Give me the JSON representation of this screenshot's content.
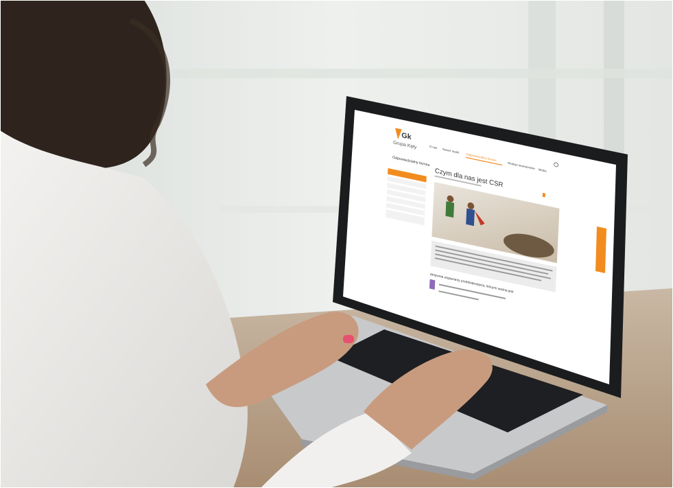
{
  "site": {
    "logo_text": "Gk",
    "logo_subtext": "Grupa Kęty",
    "nav": [
      "O nas",
      "Nasze marki",
      "Odpowiedzialny biznes",
      "Relacje inwestorskie",
      "Media"
    ],
    "page_title": "Czym dla nas jest CSR",
    "sidebar_heading": "Odpowiedzialny biznes",
    "section_heading": "Aktywnie wspieramy przedsięwzięcia, którymi ważne jest"
  },
  "colors": {
    "accent": "#f28c1e",
    "background_window": "#e9ecea",
    "laptop_body": "#c8c9cb",
    "keyboard": "#1e1f22"
  }
}
